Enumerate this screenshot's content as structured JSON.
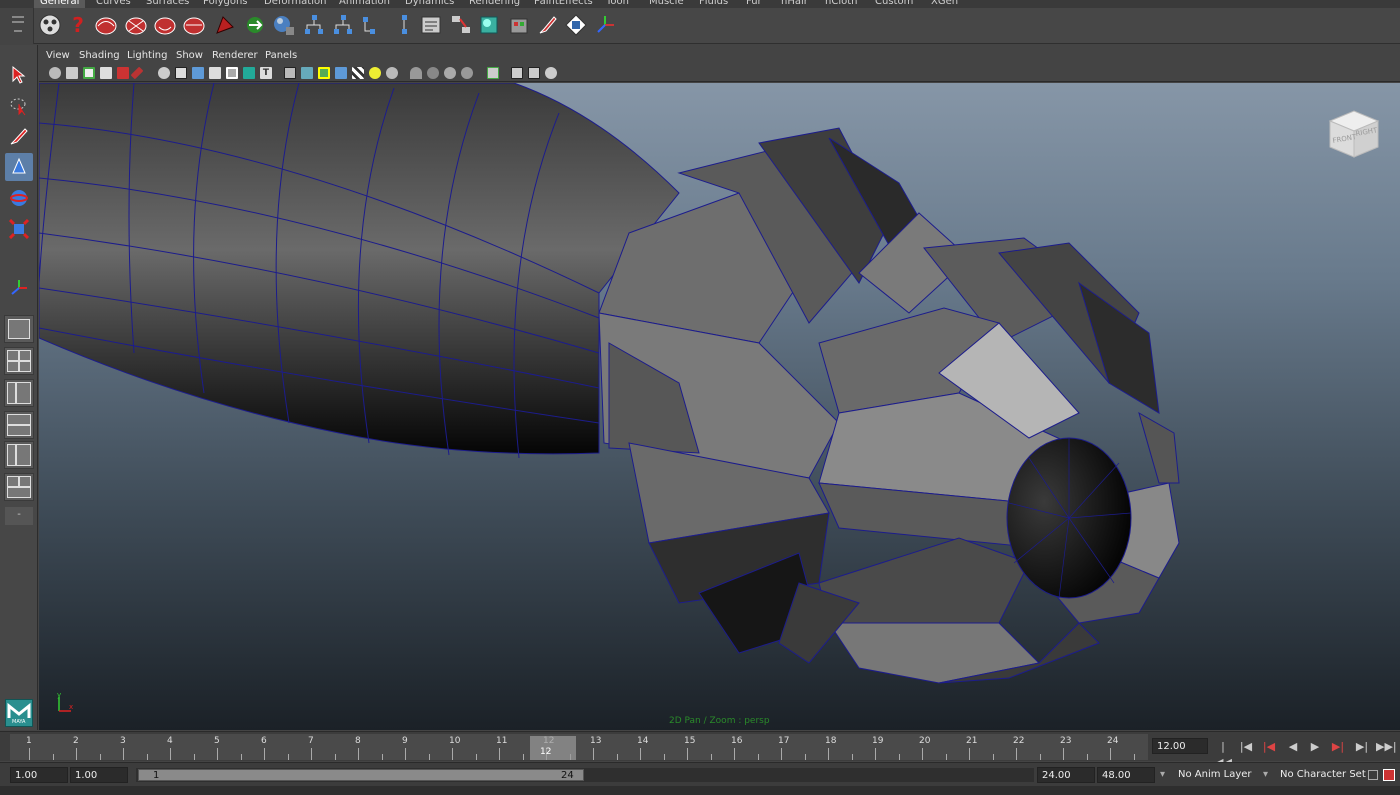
{
  "shelf": {
    "tabs": [
      "General",
      "Curves",
      "Surfaces",
      "Polygons",
      "Deformation",
      "Animation",
      "Dynamics",
      "Rendering",
      "PaintEffects",
      "Toon",
      "Muscle",
      "Fluids",
      "Fur",
      "nHair",
      "nCloth",
      "Custom",
      "XGen"
    ],
    "active_tab": "General",
    "icons": [
      "film-reel-icon",
      "help-icon",
      "brain-icon",
      "brain-scribble-icon",
      "brain-alt-icon",
      "snap-red-icon",
      "green-arrow-icon",
      "sphere-blue-icon",
      "hierarchy-icon",
      "hierarchy-alt-icon",
      "hierarchy-down-icon",
      "hierarchy-outline-icon",
      "attribute-editor-icon",
      "connections-icon",
      "render-cube-icon",
      "render-view-icon",
      "paint-brush-icon",
      "hypershade-icon",
      "move-axes-icon"
    ]
  },
  "toolbox": {
    "tools": [
      "select-tool-icon",
      "lasso-tool-icon",
      "paint-select-icon",
      "move-tool-icon",
      "rotate-tool-icon",
      "scale-tool-icon",
      "manipulator-icon"
    ],
    "active_tool": "move-tool-icon",
    "layouts": [
      "single-perspective-layout",
      "four-view-layout",
      "outliner-persp-layout",
      "graph-persp-layout",
      "hypershade-layout",
      "graph-outliner-layout"
    ],
    "collapse_glyph": "-",
    "logo_text": "MAYA"
  },
  "panel": {
    "menus": [
      "View",
      "Shading",
      "Lighting",
      "Show",
      "Renderer",
      "Panels"
    ],
    "hud_text": "2D Pan / Zoom : persp",
    "viewcube": {
      "front": "FRONT",
      "right": "RIGHT"
    },
    "axis": {
      "x": "x",
      "y": "y"
    }
  },
  "timeline": {
    "ticks": [
      "1",
      "2",
      "3",
      "4",
      "5",
      "6",
      "7",
      "8",
      "9",
      "10",
      "11",
      "12",
      "13",
      "14",
      "15",
      "16",
      "17",
      "18",
      "19",
      "20",
      "21",
      "22",
      "23",
      "24"
    ],
    "current_frame": "12",
    "current_time": "12.00",
    "playback_buttons": [
      "go-to-start-icon",
      "step-back-key-icon",
      "step-back-frame-icon",
      "play-back-icon",
      "play-forward-icon",
      "step-forward-frame-icon",
      "step-forward-key-icon",
      "go-to-end-icon"
    ]
  },
  "range": {
    "start_time": "1.00",
    "playback_start": "1.00",
    "range_start_label": "1",
    "range_end_label": "24",
    "playback_end": "24.00",
    "end_time": "48.00",
    "anim_layer": "No Anim Layer",
    "character_set": "No Character Set"
  },
  "colors": {
    "accent_blue": "#5d7fa8",
    "viewport_top": "#8696a7",
    "viewport_bottom": "#1b2127",
    "hud_green": "#2a8a2a",
    "wireframe": "#1c1c8c"
  }
}
